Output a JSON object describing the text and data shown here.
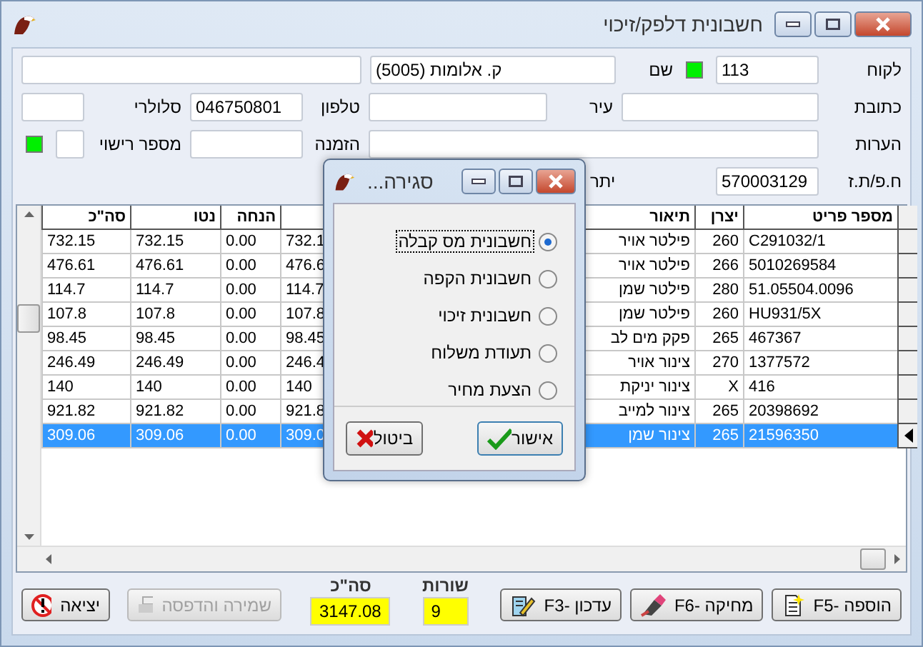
{
  "window": {
    "title": "חשבונית דלפק/זיכוי"
  },
  "form": {
    "rows": [
      {
        "fields": [
          {
            "kind": "field",
            "label": "לקוח",
            "value": "113"
          },
          {
            "kind": "indicator",
            "on": true
          },
          {
            "kind": "field",
            "label": "שם",
            "value": "ק. אלומות (5005)"
          },
          {
            "kind": "field"
          }
        ]
      },
      {
        "fields": [
          {
            "kind": "field",
            "label": "כתובת"
          },
          {
            "kind": "field",
            "label": "עיר"
          },
          {
            "kind": "field",
            "label": "טלפון",
            "value": "046750801"
          },
          {
            "kind": "field",
            "label": "סלולרי"
          }
        ]
      },
      {
        "fields": [
          {
            "kind": "field",
            "label": "הערות"
          },
          {
            "kind": "field",
            "label": "הזמנה"
          },
          {
            "kind": "field",
            "label": "מספר רישוי"
          },
          {
            "kind": "indicator",
            "on": true
          }
        ]
      },
      {
        "fields": [
          {
            "kind": "field",
            "label": "ח.פ/ת.ז",
            "value": "570003129"
          },
          {
            "kind": "caption",
            "label": "יתר"
          }
        ]
      }
    ]
  },
  "table": {
    "columns": [
      {
        "label": "מספר פריט"
      },
      {
        "label": "יצרן"
      },
      {
        "label": "תיאור"
      },
      {},
      {},
      {
        "label": "הנחה"
      },
      {
        "label": "נטו"
      },
      {
        "label": "סה\"כ"
      }
    ],
    "rows": [
      {
        "cells": [
          "C291032/1",
          "260",
          "פילטר אויר",
          "",
          "732.1",
          "0.00",
          "732.15",
          "732.15"
        ],
        "selected": false
      },
      {
        "cells": [
          "5010269584",
          "266",
          "פילטר אויר",
          "",
          "476.6",
          "0.00",
          "476.61",
          "476.61"
        ],
        "selected": false
      },
      {
        "cells": [
          "51.05504.0096",
          "280",
          "פילטר שמן",
          "",
          "114.7",
          "0.00",
          "114.7",
          "114.7"
        ],
        "selected": false
      },
      {
        "cells": [
          "HU931/5X",
          "260",
          "פילטר שמן",
          "",
          "107.8",
          "0.00",
          "107.8",
          "107.8"
        ],
        "selected": false
      },
      {
        "cells": [
          "467367",
          "265",
          "פקק מים לב",
          "",
          "98.45",
          "0.00",
          "98.45",
          "98.45"
        ],
        "selected": false
      },
      {
        "cells": [
          "1377572",
          "270",
          "צינור אויר",
          "",
          "246.4",
          "0.00",
          "246.49",
          "246.49"
        ],
        "selected": false
      },
      {
        "cells": [
          "416",
          "X",
          "צינור יניקת",
          "",
          "140",
          "0.00",
          "140",
          "140"
        ],
        "selected": false
      },
      {
        "cells": [
          "20398692",
          "265",
          "צינור למייב",
          "",
          "921.8",
          "0.00",
          "921.82",
          "921.82"
        ],
        "selected": false
      },
      {
        "cells": [
          "21596350",
          "265",
          "צינור שמן",
          "",
          "309.0",
          "0.00",
          "309.06",
          "309.06"
        ],
        "selected": true
      }
    ]
  },
  "footer": {
    "buttons": [
      {
        "kind": "add",
        "label": "הוספה -F5",
        "disabled": false
      },
      {
        "kind": "delete",
        "label": "מחיקה -F6",
        "disabled": false
      },
      {
        "kind": "edit",
        "label": "עדכון -F3",
        "disabled": false
      }
    ],
    "counters": [
      {
        "label": "שורות",
        "value": "9"
      },
      {
        "label": "סה\"כ",
        "value": "3147.08"
      }
    ],
    "save": {
      "label": "שמירה והדפסה",
      "disabled": true
    },
    "exit": {
      "label": "יציאה",
      "disabled": false
    }
  },
  "dialog": {
    "title": "סגירה...",
    "options": [
      {
        "label": "חשבונית מס קבלה",
        "selected": true
      },
      {
        "label": "חשבונית הקפה",
        "selected": false
      },
      {
        "label": "חשבונית זיכוי",
        "selected": false
      },
      {
        "label": "תעודת משלוח",
        "selected": false
      },
      {
        "label": "הצעת מחיר",
        "selected": false
      }
    ],
    "ok": "אישור",
    "cancel": "ביטול"
  }
}
